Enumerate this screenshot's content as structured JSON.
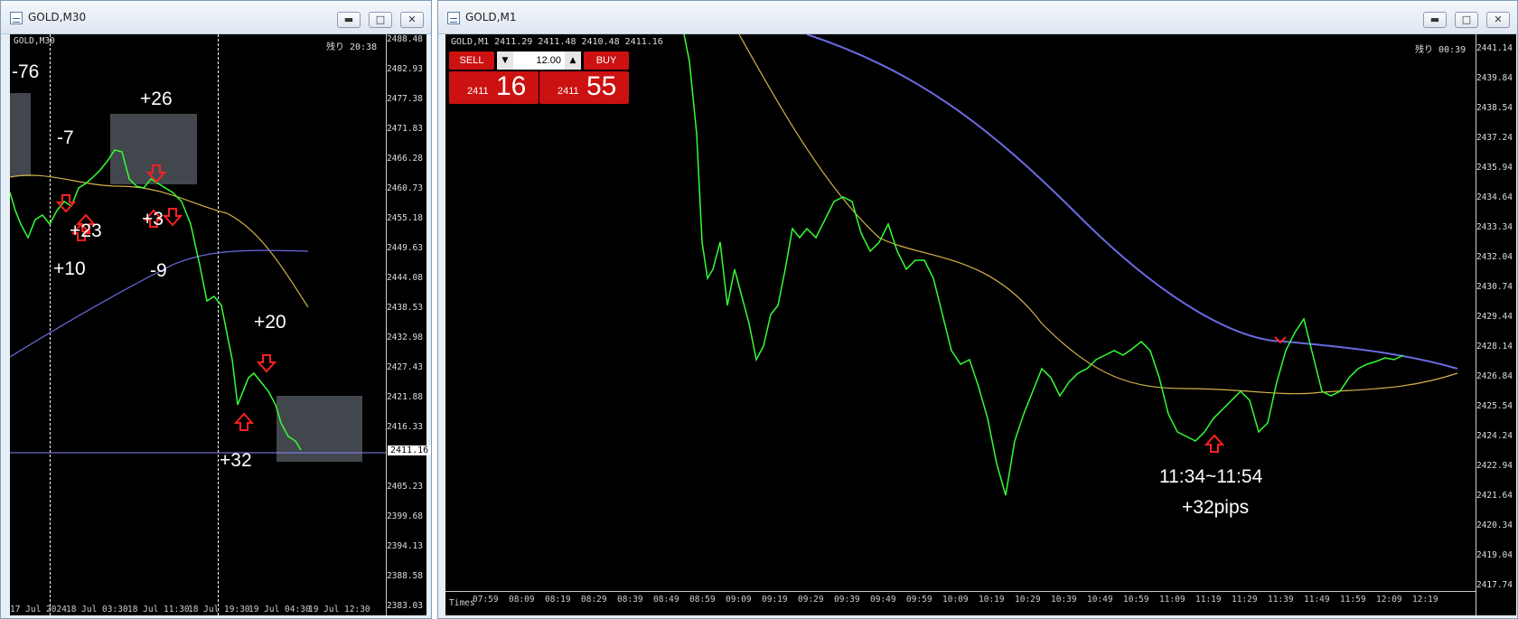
{
  "left_window": {
    "title": "GOLD,M30",
    "chart_label": "GOLD,M30",
    "remaining": "残り 20:38",
    "current_price": "2411.16",
    "price_ticks": [
      "2488.48",
      "2482.93",
      "2477.38",
      "2471.83",
      "2466.28",
      "2460.73",
      "2455.18",
      "2449.63",
      "2444.08",
      "2438.53",
      "2432.98",
      "2427.43",
      "2421.88",
      "2416.33",
      "2411.16",
      "2405.23",
      "2399.68",
      "2394.13",
      "2388.58",
      "2383.03"
    ],
    "time_ticks": [
      "17 Jul 2024",
      "18 Jul 03:30",
      "18 Jul 11:30",
      "18 Jul 19:30",
      "19 Jul 04:30",
      "19 Jul 12:30"
    ],
    "annotations": [
      "-76",
      "+26",
      "-7",
      "+23",
      "+3",
      "+10",
      "-9",
      "+20",
      "+32"
    ]
  },
  "right_window": {
    "title": "GOLD,M1",
    "chart_label": "GOLD,M1  2411.29 2411.48 2410.48 2411.16",
    "remaining": "残り 00:39",
    "price_ticks": [
      "2441.14",
      "2439.84",
      "2438.54",
      "2437.24",
      "2435.94",
      "2434.64",
      "2433.34",
      "2432.04",
      "2430.74",
      "2429.44",
      "2428.14",
      "2426.84",
      "2425.54",
      "2424.24",
      "2422.94",
      "2421.64",
      "2420.34",
      "2419.04",
      "2417.74"
    ],
    "time_ticks": [
      "Times",
      "07:59",
      "08:09",
      "08:19",
      "08:29",
      "08:39",
      "08:49",
      "08:59",
      "09:09",
      "09:19",
      "09:29",
      "09:39",
      "09:49",
      "09:59",
      "10:09",
      "10:19",
      "10:29",
      "10:39",
      "10:49",
      "10:59",
      "11:09",
      "11:19",
      "11:29",
      "11:39",
      "11:49",
      "11:59",
      "12:09",
      "12:19"
    ],
    "trade_panel": {
      "sell_label": "SELL",
      "buy_label": "BUY",
      "quantity": "12.00",
      "sell_price_small": "2411",
      "sell_price_big": "16",
      "buy_price_small": "2411",
      "buy_price_big": "55"
    },
    "annotation_time": "11:34~11:54",
    "annotation_pips": "+32pips"
  },
  "window_buttons": {
    "minimize": "▬",
    "maximize": "□",
    "close": "✕"
  },
  "colors": {
    "candle": "#33ff33",
    "ma_fast": "#d4b24a",
    "ma_slow": "#6a6ae0",
    "arrow": "#ff2020",
    "sell": "#cc1111"
  }
}
